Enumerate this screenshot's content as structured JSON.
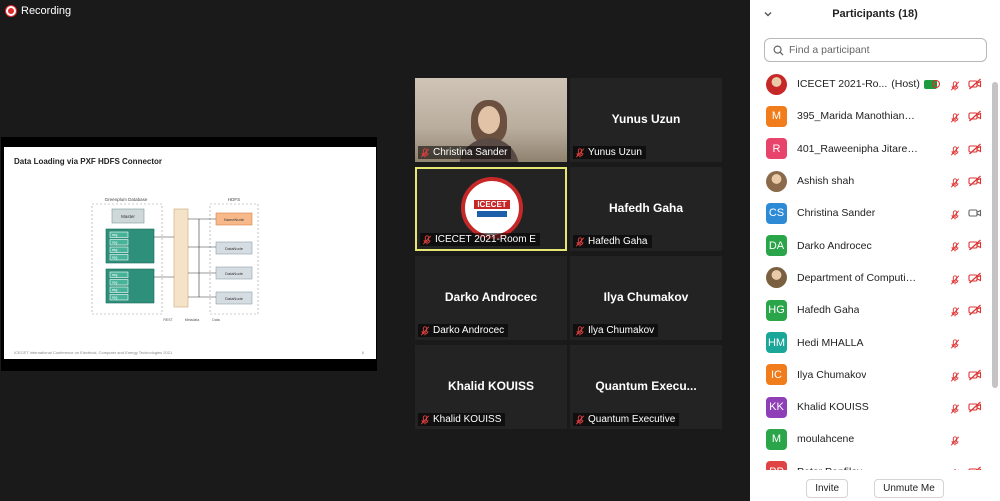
{
  "recording": {
    "label": "Recording"
  },
  "share": {
    "slide_title": "Data Loading via PXF HDFS Connector",
    "diagram": {
      "left_title": "Greenplum Database",
      "right_title": "HDFS",
      "master_label": "Master",
      "namenode_label": "NameNode",
      "datanode_label": "DataNode",
      "seg_label": "seg",
      "legend": [
        "REST",
        "Metadata",
        "Data"
      ]
    },
    "footer": "ICECET International Conference on Electrical, Computer and Energy Technologies 2021",
    "page_number": "6"
  },
  "tiles": [
    {
      "id": "christina",
      "display_name": "",
      "label": "Christina Sander",
      "type": "video"
    },
    {
      "id": "yunus",
      "display_name": "Yunus Uzun",
      "label": "Yunus Uzun",
      "type": "name"
    },
    {
      "id": "icecet",
      "display_name": "",
      "label": "ICECET 2021-Room E",
      "type": "logo",
      "logo_text": "ICECET"
    },
    {
      "id": "hafedh",
      "display_name": "Hafedh Gaha",
      "label": "Hafedh Gaha",
      "type": "name"
    },
    {
      "id": "darko",
      "display_name": "Darko Androcec",
      "label": "Darko Androcec",
      "type": "name"
    },
    {
      "id": "ilya",
      "display_name": "Ilya Chumakov",
      "label": "Ilya Chumakov",
      "type": "name"
    },
    {
      "id": "khalid",
      "display_name": "Khalid KOUISS",
      "label": "Khalid KOUISS",
      "type": "name"
    },
    {
      "id": "quantum",
      "display_name": "Quantum  Execu...",
      "label": "Quantum Executive",
      "type": "name"
    }
  ],
  "panel": {
    "title": "Participants (18)",
    "search_placeholder": "Find a participant",
    "participants": [
      {
        "name": "ICECET 2021-Ro...",
        "host": "(Host)",
        "avatar": "",
        "color": "#c62828",
        "img": true,
        "mic": "off",
        "cam": "off",
        "sharing": true,
        "recording": true
      },
      {
        "name": "395_Marida Manothiang_KMUTT",
        "avatar": "M",
        "color": "#f07c1c",
        "mic": "off",
        "cam": "off"
      },
      {
        "name": "401_Raweenipha Jitaree_KMUTT",
        "avatar": "R",
        "color": "#e8436b",
        "mic": "off",
        "cam": "off"
      },
      {
        "name": "Ashish shah",
        "avatar": "",
        "color": "#8a6a4a",
        "img": true,
        "mic": "off",
        "cam": "off"
      },
      {
        "name": "Christina Sander",
        "avatar": "CS",
        "color": "#2d8bd6",
        "mic": "off",
        "cam": "on"
      },
      {
        "name": "Darko Androcec",
        "avatar": "DA",
        "color": "#2aa54a",
        "mic": "off",
        "cam": "off"
      },
      {
        "name": "Department of Computing and...",
        "avatar": "",
        "color": "#7a6040",
        "img": true,
        "mic": "off",
        "cam": "off"
      },
      {
        "name": "Hafedh Gaha",
        "avatar": "HG",
        "color": "#2aa54a",
        "mic": "off",
        "cam": "off"
      },
      {
        "name": "Hedi MHALLA",
        "avatar": "HM",
        "color": "#1aa79a",
        "mic": "off",
        "cam": "none"
      },
      {
        "name": "Ilya Chumakov",
        "avatar": "IC",
        "color": "#f07c1c",
        "mic": "off",
        "cam": "off"
      },
      {
        "name": "Khalid KOUISS",
        "avatar": "KK",
        "color": "#8e3fb8",
        "mic": "off",
        "cam": "off"
      },
      {
        "name": "moulahcene",
        "avatar": "M",
        "color": "#2aa54a",
        "mic": "off",
        "cam": "none"
      },
      {
        "name": "Peter Panfilov",
        "avatar": "PP",
        "color": "#e04343",
        "mic": "off",
        "cam": "off"
      }
    ],
    "invite_label": "Invite",
    "unmute_label": "Unmute Me"
  }
}
